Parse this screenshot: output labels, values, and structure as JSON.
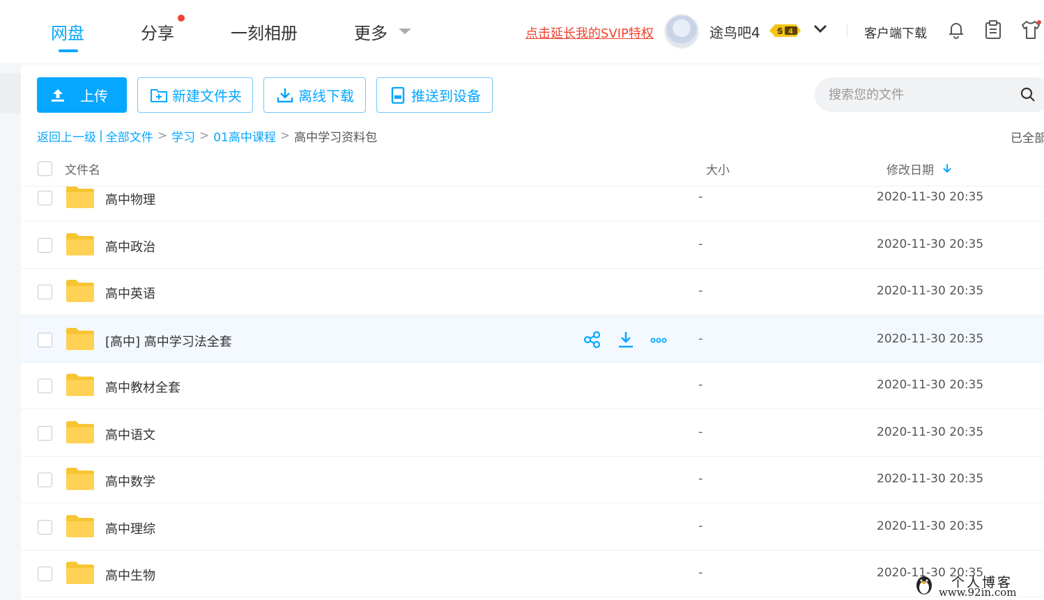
{
  "nav": {
    "tabs": [
      {
        "label": "网盘"
      },
      {
        "label": "分享"
      },
      {
        "label": "一刻相册"
      },
      {
        "label": "更多"
      }
    ],
    "active_tab": "网盘",
    "svip_link": "点击延长我的SVIP特权",
    "username": "途鸟吧4",
    "vip_badge": {
      "symbol": "S",
      "level": "4"
    },
    "client_download": "客户端下载"
  },
  "toolbar": {
    "upload": "上传",
    "new_folder": "新建文件夹",
    "offline_download": "离线下载",
    "push_to_device": "推送到设备",
    "search_placeholder": "搜索您的文件"
  },
  "breadcrumb": {
    "back": "返回上一级",
    "items": [
      "全部文件",
      "学习",
      "01高中课程"
    ],
    "current": "高中学习资料包",
    "loaded_status": "已全部"
  },
  "table": {
    "headers": {
      "name": "文件名",
      "size": "大小",
      "date": "修改日期"
    },
    "rows": [
      {
        "name": "高中物理",
        "size": "-",
        "date": "2020-11-30 20:35"
      },
      {
        "name": "高中政治",
        "size": "-",
        "date": "2020-11-30 20:35"
      },
      {
        "name": "高中英语",
        "size": "-",
        "date": "2020-11-30 20:35"
      },
      {
        "name": "[高中] 高中学习法全套",
        "size": "-",
        "date": "2020-11-30 20:35"
      },
      {
        "name": "高中教材全套",
        "size": "-",
        "date": "2020-11-30 20:35"
      },
      {
        "name": "高中语文",
        "size": "-",
        "date": "2020-11-30 20:35"
      },
      {
        "name": "高中数学",
        "size": "-",
        "date": "2020-11-30 20:35"
      },
      {
        "name": "高中理综",
        "size": "-",
        "date": "2020-11-30 20:35"
      },
      {
        "name": "高中生物",
        "size": "-",
        "date": "2020-11-30 20:35"
      }
    ],
    "hovered_row": 3
  },
  "watermark": {
    "title": "个人博客",
    "url": "www.92in.com"
  },
  "colors": {
    "accent": "#06a7ff",
    "svip_red": "#f0422e",
    "folder": "#ffd255",
    "notice_dot": "#f04134"
  }
}
